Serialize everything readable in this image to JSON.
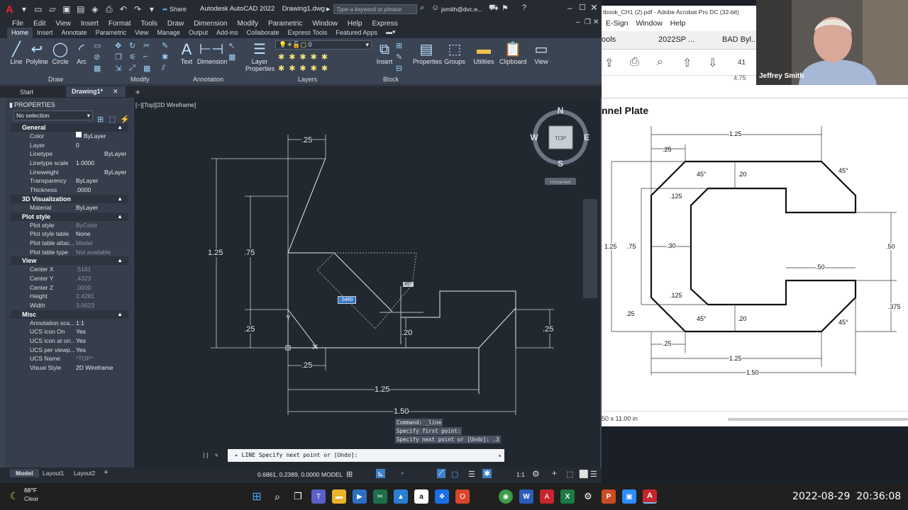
{
  "title_bar": {
    "share_label": "Share",
    "title": "Autodesk AutoCAD 2022    Drawing1.dwg",
    "search_placeholder": "Type a keyword or phrase",
    "user": "jsmith@dvc.e..."
  },
  "menu": [
    "File",
    "Edit",
    "View",
    "Insert",
    "Format",
    "Tools",
    "Draw",
    "Dimension",
    "Modify",
    "Parametric",
    "Window",
    "Help",
    "Express"
  ],
  "ribbon_tabs": [
    "Home",
    "Insert",
    "Annotate",
    "Parametric",
    "View",
    "Manage",
    "Output",
    "Add-ins",
    "Collaborate",
    "Express Tools",
    "Featured Apps"
  ],
  "ribbon": {
    "draw_tools": [
      "Line",
      "Polyline",
      "Circle",
      "Arc"
    ],
    "draw_label": "Draw",
    "modify_label": "Modify",
    "annotation_tools": [
      "Text",
      "Dimension"
    ],
    "annotation_label": "Annotation",
    "layer_properties": "Layer\nProperties",
    "layer_value": "0",
    "layers_label": "Layers",
    "insert_label": "Insert",
    "block_label": "Block",
    "groups": [
      "Properties",
      "Groups",
      "Utilities",
      "Clipboard",
      "View"
    ]
  },
  "doc_tabs": [
    "Start",
    "Drawing1*"
  ],
  "properties": {
    "header": "PROPERTIES",
    "selection": "No selection",
    "sections": [
      {
        "name": "General",
        "rows": [
          [
            "Color",
            "ByLayer"
          ],
          [
            "Layer",
            "0"
          ],
          [
            "Linetype",
            "ByLayer"
          ],
          [
            "Linetype scale",
            "1.0000"
          ],
          [
            "Lineweight",
            "ByLayer"
          ],
          [
            "Transparency",
            "ByLayer"
          ],
          [
            "Thickness",
            ".0000"
          ]
        ]
      },
      {
        "name": "3D Visualization",
        "rows": [
          [
            "Material",
            "ByLayer"
          ]
        ]
      },
      {
        "name": "Plot style",
        "rows": [
          [
            "Plot style",
            "ByColor"
          ],
          [
            "Plot style table",
            "None"
          ],
          [
            "Plot table attac...",
            "Model"
          ],
          [
            "Plot table type",
            "Not available"
          ]
        ]
      },
      {
        "name": "View",
        "rows": [
          [
            "Center X",
            ".5161"
          ],
          [
            "Center Y",
            ".4323"
          ],
          [
            "Center Z",
            ".0000"
          ],
          [
            "Height",
            "2.4281"
          ],
          [
            "Width",
            "3.0623"
          ]
        ]
      },
      {
        "name": "Misc",
        "rows": [
          [
            "Annotation sca...",
            "1:1"
          ],
          [
            "UCS icon On",
            "Yes"
          ],
          [
            "UCS icon at ori...",
            "Yes"
          ],
          [
            "UCS per viewp...",
            "Yes"
          ],
          [
            "UCS Name",
            "*TOP*"
          ],
          [
            "Visual Style",
            "2D Wireframe"
          ]
        ]
      }
    ]
  },
  "viewport": {
    "label": "[−][Top][2D Wireframe]",
    "compass": {
      "n": "N",
      "s": "S",
      "e": "E",
      "w": "W",
      "top": "TOP"
    },
    "unnamed": "Unnamed",
    "dims": {
      "d1": ".25",
      "d2": "1.25",
      "d3": ".75",
      "d4": ".25",
      "d5": ".25",
      "d6": "1.25",
      "d7": "1.50",
      "d8": ".20",
      "d9": ".25",
      "angle": "45°",
      "input": ".5460"
    },
    "cmd_history": [
      "Command: _line",
      "Specify first point:",
      "Specify next point or [Undo]: .3"
    ],
    "cmd_line": "LINE Specify next point or [Undo]:"
  },
  "layout_tabs": [
    "Model",
    "Layout1",
    "Layout2"
  ],
  "status": {
    "coords": "0.6861, 0.2389, 0.0000",
    "model": "MODEL",
    "scale": "1:1"
  },
  "acrobat": {
    "title": "tbook_CH1 (2).pdf - Adobe Acrobat Pro DC (32-bit)",
    "menu": [
      "E-Sign",
      "Window",
      "Help"
    ],
    "tabs": [
      "ools",
      "2022SP ...",
      "BAD Byl..."
    ],
    "page_num": "41",
    "heading": "nnel Plate",
    "size": "50 x 11.00 in",
    "dims": {
      "top": "1.25",
      "tl": ".25",
      "a1": "45°",
      "g1": ".20",
      "a2": "45°",
      "r125": ".125",
      "h125": "1.25",
      "h75": ".75",
      "w30": ".30",
      "w50": ".50",
      "r50": ".50",
      "r125b": ".125",
      "b25": ".25",
      "a3": "45°",
      "g2": ".20",
      "a4": "45°",
      "r375": ".375",
      "bl": ".25",
      "b125": "1.25",
      "b150": "1.50",
      "t475": "4.75"
    }
  },
  "webcam": {
    "name": "Jeffrey Smith"
  },
  "taskbar": {
    "weather_temp": "68°F",
    "weather_desc": "Clear",
    "datetime": "2022-08-29  20:36:08"
  }
}
